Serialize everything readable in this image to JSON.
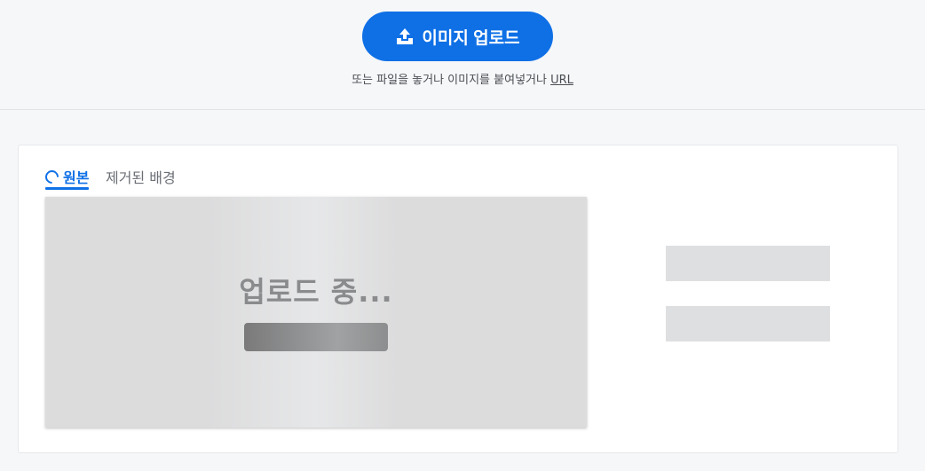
{
  "header": {
    "upload_button_label": "이미지 업로드",
    "hint_text": "또는 파일을 놓거나 이미지를 붙여넣거나",
    "hint_link": "URL",
    "accent_color": "#0f70e6"
  },
  "tabs": [
    {
      "label": "원본",
      "active": true,
      "icon": "loading-spinner-icon"
    },
    {
      "label": "제거된 배경",
      "active": false
    }
  ],
  "preview": {
    "status_text": "업로드 중..."
  }
}
